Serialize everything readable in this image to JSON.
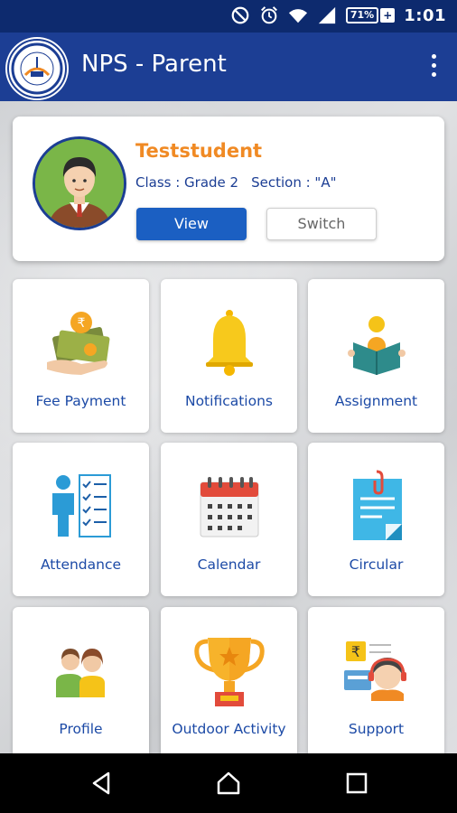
{
  "status_bar": {
    "battery_percent": "71%",
    "battery_plus": "+",
    "time": "1:01",
    "icons": [
      "do-not-disturb-icon",
      "alarm-icon",
      "wifi-icon",
      "signal-icon",
      "battery-icon"
    ]
  },
  "app_bar": {
    "title": "NPS - Parent",
    "menu_icon": "more-vert-icon",
    "colors": {
      "status": "#0d2a6e",
      "appbar": "#1c3e94"
    }
  },
  "student": {
    "name": "Teststudent",
    "class_text": "Class : Grade 2",
    "section_text": "Section : \"A\"",
    "view_label": "View",
    "switch_label": "Switch"
  },
  "tiles": [
    {
      "label": "Fee Payment",
      "icon": "fee-payment-icon"
    },
    {
      "label": "Notifications",
      "icon": "bell-icon"
    },
    {
      "label": "Assignment",
      "icon": "reading-student-icon"
    },
    {
      "label": "Attendance",
      "icon": "attendance-checklist-icon"
    },
    {
      "label": "Calendar",
      "icon": "calendar-icon"
    },
    {
      "label": "Circular",
      "icon": "circular-document-icon"
    },
    {
      "label": "Profile",
      "icon": "profile-people-icon"
    },
    {
      "label": "Outdoor Activity",
      "icon": "trophy-icon"
    },
    {
      "label": "Support",
      "icon": "support-agent-icon"
    }
  ],
  "nav_bar": {
    "icons": [
      "back-triangle-icon",
      "home-icon",
      "recents-square-icon"
    ]
  },
  "colors": {
    "accent_orange": "#f08a24",
    "primary_blue": "#1b5fc2",
    "label_blue": "#1c4aa6"
  }
}
